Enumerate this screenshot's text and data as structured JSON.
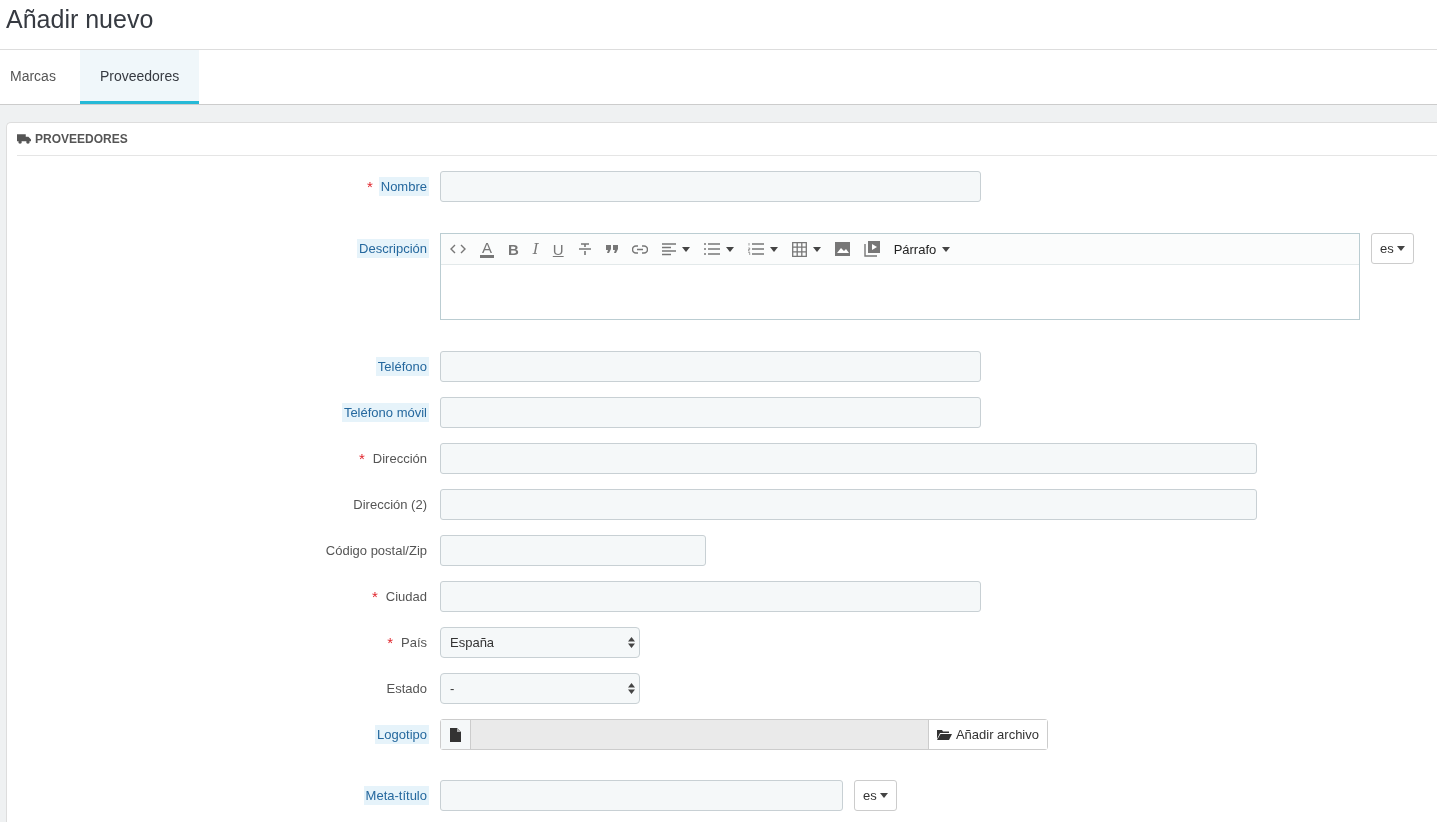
{
  "page_title": "Añadir nuevo",
  "tabs": [
    {
      "label": "Marcas",
      "selected": false
    },
    {
      "label": "Proveedores",
      "selected": true
    }
  ],
  "panel": {
    "title": "PROVEEDORES"
  },
  "editor_toolbar": [
    {
      "kind": "code"
    },
    {
      "kind": "color",
      "text": "A"
    },
    {
      "kind": "bold",
      "text": "B"
    },
    {
      "kind": "italic",
      "text": "I"
    },
    {
      "kind": "underline",
      "text": "U"
    },
    {
      "kind": "strike"
    },
    {
      "kind": "quote"
    },
    {
      "kind": "link"
    },
    {
      "kind": "align"
    },
    {
      "kind": "bullets"
    },
    {
      "kind": "numbers"
    },
    {
      "kind": "table"
    },
    {
      "kind": "image"
    },
    {
      "kind": "video"
    },
    {
      "kind": "format",
      "text": "Párrafo"
    }
  ],
  "fields": [
    {
      "asterisk": "*",
      "label": "Nombre",
      "hint": true,
      "kind": "text"
    },
    {
      "label": "Descripción",
      "hint": true,
      "kind": "editor",
      "lang": "es"
    },
    {
      "label": "Teléfono",
      "hint": true,
      "kind": "text"
    },
    {
      "label": "Teléfono móvil",
      "hint": true,
      "kind": "text"
    },
    {
      "asterisk": "*",
      "label": "Dirección",
      "hint": false,
      "kind": "wide"
    },
    {
      "label": "Dirección (2)",
      "hint": false,
      "kind": "wide"
    },
    {
      "label": "Código postal/Zip",
      "hint": false,
      "kind": "short"
    },
    {
      "asterisk": "*",
      "label": "Ciudad",
      "hint": false,
      "kind": "text"
    },
    {
      "asterisk": "*",
      "label": "País",
      "hint": false,
      "kind": "select",
      "value": "España"
    },
    {
      "label": "Estado",
      "hint": false,
      "kind": "select",
      "value": "-"
    },
    {
      "label": "Logotipo",
      "hint": true,
      "kind": "file",
      "button": "Añadir archivo"
    },
    {
      "label": "Meta-título",
      "hint": true,
      "kind": "title",
      "lang": "es"
    }
  ]
}
